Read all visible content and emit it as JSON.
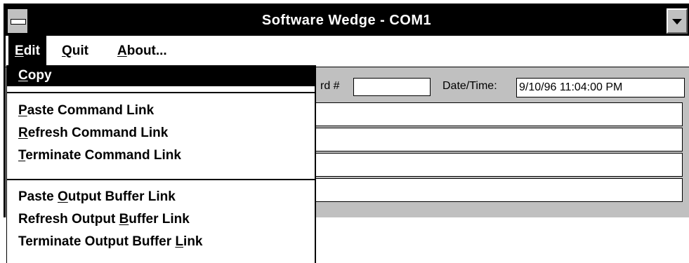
{
  "window": {
    "title": "Software Wedge - COM1",
    "system_menu_icon": "system-menu-icon",
    "dropdown_icon": "down-arrow-icon"
  },
  "menubar": {
    "items": [
      {
        "prefix": "",
        "key": "E",
        "rest": "dit",
        "active": true
      },
      {
        "prefix": "",
        "key": "Q",
        "rest": "uit",
        "active": false
      },
      {
        "prefix": "",
        "key": "A",
        "rest": "bout...",
        "active": false
      }
    ]
  },
  "edit_menu": {
    "items": [
      {
        "prefix": "",
        "key": "C",
        "rest": "opy",
        "active": true
      },
      {
        "prefix": "",
        "key": "P",
        "rest": "aste Command Link"
      },
      {
        "prefix": "",
        "key": "R",
        "rest": "efresh Command Link"
      },
      {
        "prefix": "",
        "key": "T",
        "rest": "erminate Command Link"
      },
      {
        "prefix": "Paste ",
        "key": "O",
        "rest": "utput Buffer Link"
      },
      {
        "prefix": "Refresh Output ",
        "key": "B",
        "rest": "uffer Link"
      },
      {
        "prefix": "Terminate Output Buffer ",
        "key": "L",
        "rest": "ink"
      }
    ]
  },
  "form": {
    "record_label": "rd #",
    "record_value": "",
    "datetime_label": "Date/Time:",
    "datetime_value": "9/10/96 11:04:00 PM",
    "field_rows": [
      "",
      "",
      "",
      ""
    ]
  },
  "colors": {
    "titlebar": "#000000",
    "window_bg": "#c0c0c0",
    "menu_bg": "#ffffff",
    "highlight": "#000000"
  }
}
